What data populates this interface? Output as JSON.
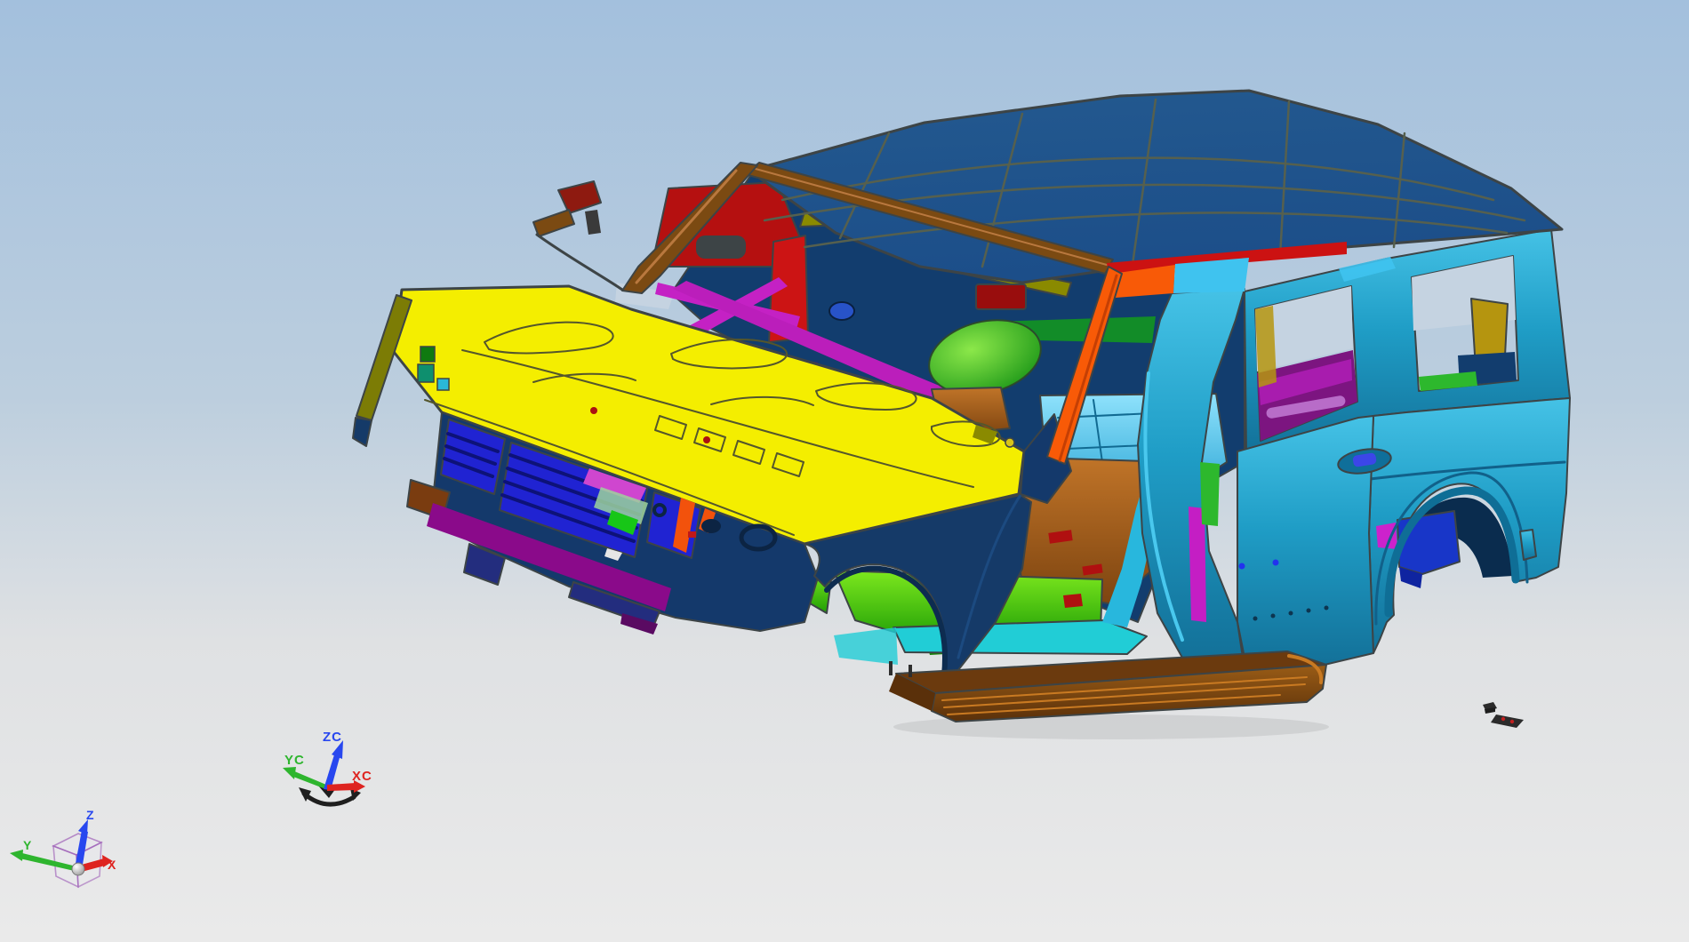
{
  "viewport": {
    "background": {
      "top": "#a3c0dd",
      "upper_mid": "#bccede",
      "lower_mid": "#dfe1e3",
      "bottom": "#eaeaea"
    },
    "outline_color": "#3d4446",
    "sky_through_openings": "#c5d3e1"
  },
  "triads": {
    "wcs": {
      "z": "ZC",
      "y": "YC",
      "x": "XC",
      "z_color": "#2847ef",
      "y_color": "#2eb52e",
      "x_color": "#de2420",
      "handle_color": "#1f1f1f"
    },
    "absolute": {
      "z": "Z",
      "y": "Y",
      "x": "X",
      "z_color": "#2847ef",
      "y_color": "#2eb52e",
      "x_color": "#de2420",
      "cube_edge_color": "#9b59b6",
      "cube_face_color": "#e8e8ec"
    }
  },
  "model": {
    "description": "SUV body-in-white, multi-colored sheet metal parts, front-left isometric view",
    "parts": {
      "roof": {
        "color": "#1c4e89",
        "light": "#23598f",
        "line_color": "#56604e"
      },
      "roof_rail_brown": {
        "color": "#7b4a12",
        "highlight": "#b9783e"
      },
      "eave_red": {
        "color": "#cc1212"
      },
      "eave_orange": {
        "color": "#f85a07"
      },
      "eave_cyan": {
        "color": "#3fc3ef"
      },
      "hood": {
        "color": "#f4ee00",
        "line_color": "#54562c",
        "dot_red": "#aa1111"
      },
      "fender_olive": {
        "color": "#7c7c05"
      },
      "fender_navy": {
        "color": "#153a68",
        "light": "#1c4a80",
        "hole": "#0c2443"
      },
      "front_clip_navy": {
        "color": "#14396b"
      },
      "grille_blue": {
        "color": "#2023d2",
        "slat": "#0d1278"
      },
      "radiator_pink": {
        "color": "#cf46cf"
      },
      "mesh_green": {
        "color": "#9cd39c"
      },
      "front_green": {
        "color": "#17c617"
      },
      "front_orange": {
        "color": "#f2520c"
      },
      "bumper_purple": {
        "color": "#8a0a8a"
      },
      "corner_brown": {
        "color": "#7a3c10"
      },
      "lower_dark_blue": {
        "color": "#232d7e"
      },
      "lower_purple": {
        "color": "#5a0a62"
      },
      "white_bit": {
        "color": "#e6e6e6"
      },
      "mirror_bracket_red": {
        "color": "#8e1a10"
      },
      "apillar_orange": {
        "color": "#f85a07",
        "dark": "#c43f04"
      },
      "interior_navy": {
        "color": "#123d6e"
      },
      "header_red": {
        "color": "#b51010"
      },
      "bow_olive": {
        "color": "#8a8a00"
      },
      "channel_red": {
        "color": "#cc1414"
      },
      "brace_magenta": {
        "color": "#c421c4"
      },
      "brace_purple": {
        "color": "#6e0d78"
      },
      "cowl_magenta": {
        "color": "#bb1ebb"
      },
      "cowl_purple": {
        "color": "#7a1184"
      },
      "cowl_brown": {
        "color": "#a2591a"
      },
      "seat_green": {
        "light": "#8ce84a",
        "dark": "#149114"
      },
      "dash_green": {
        "color": "#128c28"
      },
      "dash_red": {
        "color": "#990d0d"
      },
      "speaker_blue": {
        "color": "#2853c8"
      },
      "floor_lightblue": {
        "light": "#8fe2fc",
        "dark": "#2aa4d4"
      },
      "floor_copper": {
        "light": "#c07428",
        "dark": "#7d4410"
      },
      "floor_green": {
        "light": "#7de81e",
        "dark": "#1f9e06",
        "edge": "#168505",
        "red_mark": "#b01010"
      },
      "sill_cyan": {
        "color": "#21cdd6",
        "upsweep": "#28b7dd"
      },
      "body_teal": {
        "light": "#45c2e6",
        "base": "#1f9dc6",
        "dark": "#137199",
        "crease": "#11618a",
        "arch_lip": "#0f6e96"
      },
      "bpillar_strip_magenta": {
        "color": "#c41ec4"
      },
      "bpillar_strip_green": {
        "color": "#2db82d"
      },
      "strip_blue": {
        "color": "#2230dd"
      },
      "strip_gold": {
        "color": "#c9960e"
      },
      "cargo_purple": {
        "color": "#7c1580"
      },
      "cargo_magenta": {
        "color": "#a81cae"
      },
      "cargo_lavender": {
        "color": "#b86cc8"
      },
      "quarter_gold": {
        "color": "#b5950f"
      },
      "arch_box_blue": {
        "color": "#1836c8",
        "dark": "#0f24a0"
      },
      "arch_shadow": {
        "color": "#0a2c4e"
      },
      "arch_sliver_magenta": {
        "color": "#cc22cc"
      },
      "door_handle": {
        "recess": "#0f6f9a",
        "glyph": "#3c46e8"
      },
      "rivet_blue": {
        "color": "#2233ee"
      },
      "weld_dot": {
        "color": "#0d3550"
      },
      "rocker": {
        "top": "#6b3a0e",
        "face": "#9a5c16",
        "dark": "#5a300a",
        "glow": "#c97a22"
      }
    },
    "debris": {
      "color": "#2b2b2b",
      "red_dot": "#c02020"
    }
  }
}
